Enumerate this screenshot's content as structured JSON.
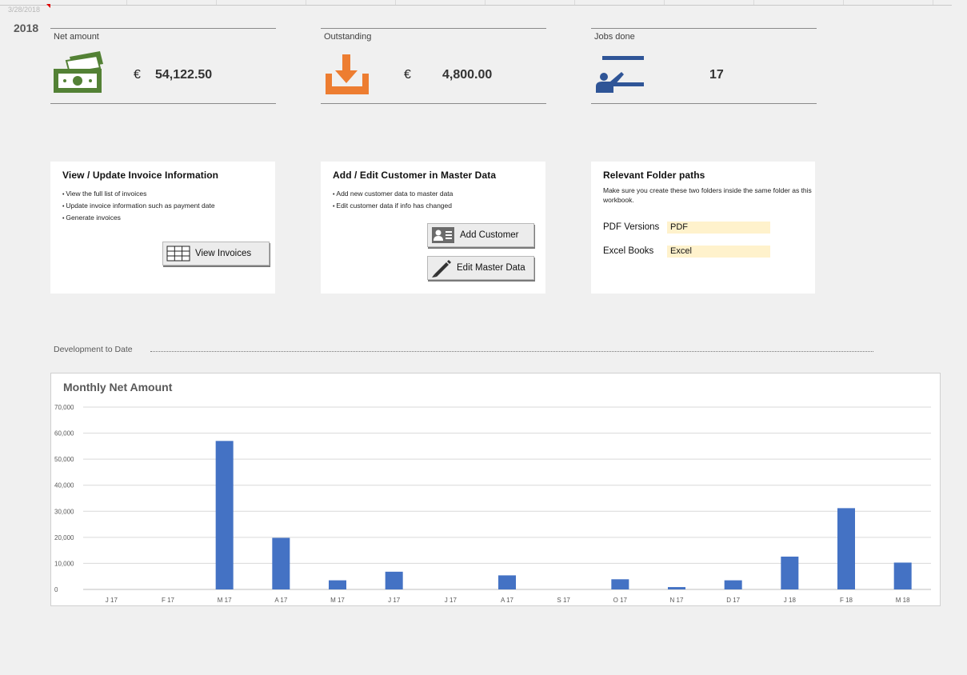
{
  "sheet": {
    "date": "3/28/2018",
    "year": "2018"
  },
  "kpis": [
    {
      "label": "Net amount",
      "currency": "€",
      "value": "54,122.50",
      "icon": "cash-icon",
      "color": "#538135"
    },
    {
      "label": "Outstanding",
      "currency": "€",
      "value": "4,800.00",
      "icon": "download-tray-icon",
      "color": "#ed7d31"
    },
    {
      "label": "Jobs done",
      "currency": "",
      "value": "17",
      "icon": "presenter-board-icon",
      "color": "#2f5597"
    }
  ],
  "panels": {
    "invoice": {
      "title": "View / Update Invoice Information",
      "items": [
        "View the full list of invoices",
        "Update invoice information such as payment date",
        "Generate invoices"
      ],
      "button_label": "View Invoices",
      "button_icon": "grid-table-icon"
    },
    "customer": {
      "title": "Add / Edit Customer in Master Data",
      "items": [
        "Add new customer data to master data",
        "Edit customer data if info has changed"
      ],
      "add_button_label": "Add Customer",
      "add_button_icon": "contact-card-icon",
      "edit_button_label": "Edit Master Data",
      "edit_button_icon": "pencil-icon"
    },
    "folders": {
      "title": "Relevant Folder paths",
      "description": "Make sure you create these two folders inside the same folder as this workbook.",
      "pdf_label": "PDF Versions",
      "pdf_value": "PDF",
      "excel_label": "Excel Books",
      "excel_value": "Excel",
      "highlight_color": "#fff2cc"
    }
  },
  "section": {
    "development_label": "Development to Date"
  },
  "chart_data": {
    "type": "bar",
    "title": "Monthly Net Amount",
    "categories": [
      "J 17",
      "F 17",
      "M 17",
      "A 17",
      "M 17",
      "J 17",
      "J 17",
      "A 17",
      "S 17",
      "O 17",
      "N 17",
      "D 17",
      "J 18",
      "F 18",
      "M 18"
    ],
    "values": [
      0,
      0,
      57000,
      19800,
      3500,
      6800,
      0,
      5400,
      0,
      3900,
      900,
      3500,
      12600,
      31200,
      10300
    ],
    "ylim": [
      0,
      70000
    ],
    "yticks": [
      0,
      10000,
      20000,
      30000,
      40000,
      50000,
      60000,
      70000
    ],
    "ytick_labels": [
      "0",
      "10,000",
      "20,000",
      "30,000",
      "40,000",
      "50,000",
      "60,000",
      "70,000"
    ],
    "bar_color": "#4472c4",
    "grid": true,
    "legend": "none"
  }
}
